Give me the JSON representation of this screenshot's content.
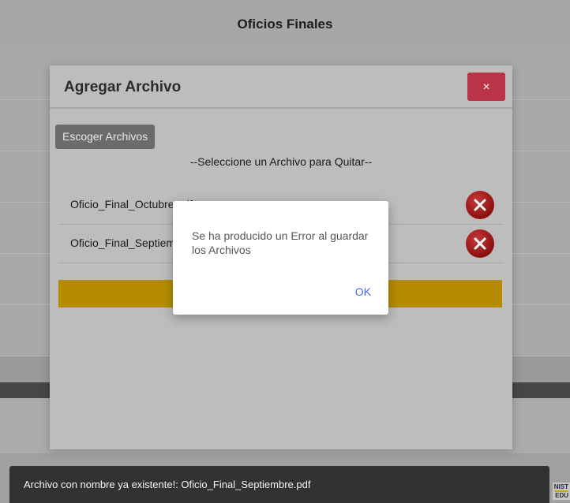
{
  "page": {
    "title": "Oficios Finales",
    "logo_text_line1": "NIST",
    "logo_text_line2": "EDU"
  },
  "modal": {
    "title": "Agregar Archivo",
    "close_label": "×",
    "choose_button": "Escoger Archivos",
    "hint": "--Seleccione un Archivo para Quitar--",
    "files": [
      {
        "name": "Oficio_Final_Octubre.pdf"
      },
      {
        "name": "Oficio_Final_Septiembre.pdf"
      }
    ],
    "remove_icon": "x-circle-icon",
    "accent_color": "#b58c00",
    "close_color": "#b83446"
  },
  "dialog": {
    "message": "Se ha producido un Error al guardar los Archivos",
    "ok_label": "OK"
  },
  "toast": {
    "text": "Archivo con nombre ya existente!: Oficio_Final_Septiembre.pdf"
  }
}
